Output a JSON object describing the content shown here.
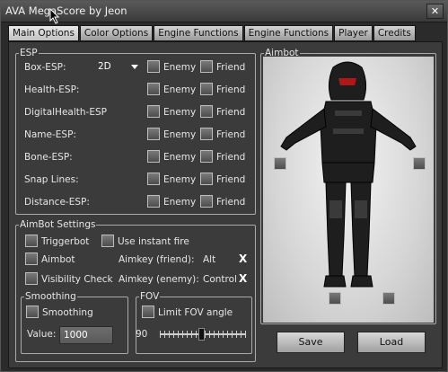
{
  "window": {
    "title": "AVA MegaScore by Jeon",
    "close_label": "✕"
  },
  "tabs": [
    {
      "label": "Main Options",
      "active": true
    },
    {
      "label": "Color Options",
      "active": false
    },
    {
      "label": "Engine Functions",
      "active": false
    },
    {
      "label": "Engine Functions",
      "active": false
    },
    {
      "label": "Player",
      "active": false
    },
    {
      "label": "Credits",
      "active": false
    }
  ],
  "esp": {
    "legend": "ESP",
    "enemy_label": "Enemy",
    "friend_label": "Friend",
    "rows": [
      {
        "label": "Box-ESP:",
        "dropdown": "2D"
      },
      {
        "label": "Health-ESP:"
      },
      {
        "label": "DigitalHealth-ESP"
      },
      {
        "label": "Name-ESP:"
      },
      {
        "label": "Bone-ESP:"
      },
      {
        "label": "Snap Lines:"
      },
      {
        "label": "Distance-ESP:"
      }
    ]
  },
  "aimbot_settings": {
    "legend": "AimBot Settings",
    "triggerbot": "Triggerbot",
    "instant_fire": "Use instant fire",
    "aimbot": "Aimbot",
    "visibility_check": "Visibility Check",
    "aimkey_friend_label": "Aimkey (friend):",
    "aimkey_friend_value": "Alt",
    "aimkey_enemy_label": "Aimkey (enemy):",
    "aimkey_enemy_value": "Control",
    "clear_mark": "X"
  },
  "smoothing": {
    "legend": "Smoothing",
    "checkbox_label": "Smoothing",
    "value_label": "Value:",
    "value": "1000"
  },
  "fov": {
    "legend": "FOV",
    "checkbox_label": "Limit FOV angle",
    "value": "90",
    "slider_fraction": 0.48
  },
  "aimbot_panel": {
    "legend": "Aimbot"
  },
  "buttons": {
    "save": "Save",
    "load": "Load"
  }
}
